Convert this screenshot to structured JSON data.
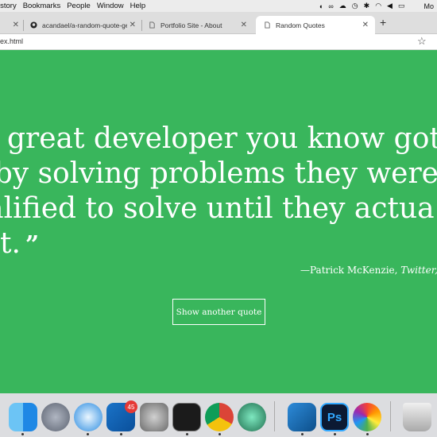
{
  "menubar": {
    "items": [
      "istory",
      "Bookmarks",
      "People",
      "Window",
      "Help"
    ]
  },
  "tabs": [
    {
      "label": "acandael/a-random-quote-gen",
      "icon": "github-icon"
    },
    {
      "label": "Portfolio Site - About",
      "icon": "page-icon"
    },
    {
      "label": "Random Quotes",
      "icon": "page-icon",
      "active": true
    }
  ],
  "addressbar": {
    "url": "ex.html"
  },
  "quote": {
    "lines": [
      "ry great developer you know got",
      "e by solving problems they were",
      "ualified to solve until they actua",
      "t."
    ],
    "close_mark": "”",
    "author_prefix": "—Patrick McKenzie, ",
    "author_source": "Twitter,"
  },
  "button": {
    "label": "Show another quote"
  },
  "colors": {
    "background": "#39b65c",
    "text": "#ffffff"
  },
  "dock": {
    "mail_badge": "45",
    "apps": [
      "finder-icon",
      "launchpad-icon",
      "safari-icon",
      "outlook-icon",
      "system-preferences-icon",
      "terminal-icon",
      "chrome-icon",
      "atom-icon",
      "vscode-icon",
      "photoshop-icon",
      "photos-icon",
      "trash-icon"
    ]
  }
}
